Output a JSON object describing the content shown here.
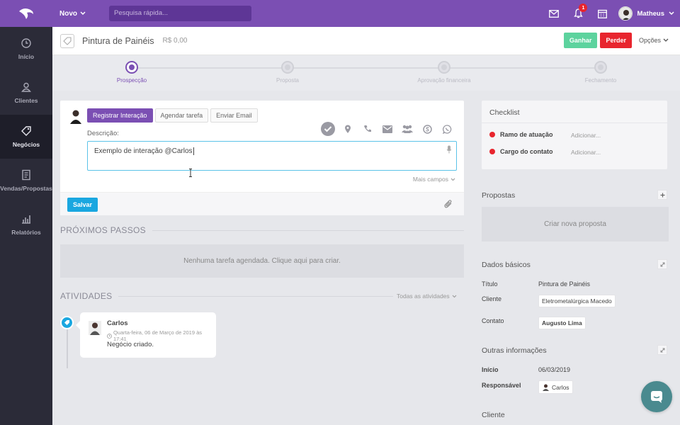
{
  "topbar": {
    "new_label": "Novo",
    "search_placeholder": "Pesquisa rápida...",
    "notification_count": "1",
    "user_name": "Matheus"
  },
  "sidebar": {
    "items": [
      {
        "label": "Início",
        "icon": "clock-icon"
      },
      {
        "label": "Clientes",
        "icon": "user-icon"
      },
      {
        "label": "Negócios",
        "icon": "tag-icon"
      },
      {
        "label": "Vendas/Propostas",
        "icon": "document-icon"
      },
      {
        "label": "Relatórios",
        "icon": "chart-icon"
      }
    ]
  },
  "deal": {
    "title": "Pintura de Painéis",
    "value": "R$ 0,00",
    "win_label": "Ganhar",
    "lose_label": "Perder",
    "options_label": "Opções"
  },
  "pipeline": {
    "stages": [
      "Prospecção",
      "Proposta",
      "Aprovação financeira",
      "Fechamento"
    ],
    "active_index": 0
  },
  "interaction": {
    "tabs": [
      "Registrar Interação",
      "Agendar tarefa",
      "Enviar Email"
    ],
    "description_label": "Descrição:",
    "description_value": "Exemplo de interação @Carlos",
    "more_fields": "Mais campos",
    "save_label": "Salvar"
  },
  "next_steps": {
    "title": "PRÓXIMOS PASSOS",
    "empty_text": "Nenhuma tarefa agendada. Clique aqui para criar."
  },
  "activities": {
    "title": "ATIVIDADES",
    "filter_label": "Todas as atividades",
    "items": [
      {
        "author": "Carlos",
        "date": "Quarta-feira, 06 de Março de 2019 às 17:41",
        "text": "Negócio criado."
      }
    ]
  },
  "checklist": {
    "title": "Checklist",
    "items": [
      {
        "label": "Ramo de atuação",
        "action": "Adicionar..."
      },
      {
        "label": "Cargo do contato",
        "action": "Adicionar..."
      }
    ]
  },
  "proposals": {
    "title": "Propostas",
    "create_label": "Criar nova proposta"
  },
  "basic_data": {
    "title": "Dados básicos",
    "title_label": "Título",
    "title_value": "Pintura de Painéis",
    "client_label": "Cliente",
    "client_value": "Eletrometalúrgica Macedo",
    "contact_label": "Contato",
    "contact_value": "Augusto Lima"
  },
  "other_info": {
    "title": "Outras informações",
    "start_label": "Início",
    "start_value": "06/03/2019",
    "owner_label": "Responsável",
    "owner_value": "Carlos"
  },
  "client_section": {
    "title": "Cliente"
  },
  "colors": {
    "brand_purple": "#7b4fb3",
    "sidebar_dark": "#2b2b38",
    "save_blue": "#1aa7e0",
    "win_green": "#5dd39e",
    "lose_red": "#e8252e"
  }
}
